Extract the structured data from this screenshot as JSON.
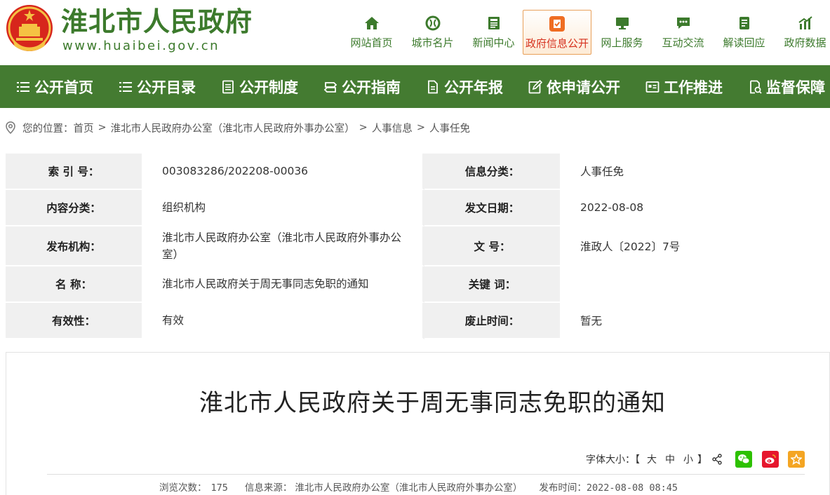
{
  "header": {
    "title": "淮北市人民政府",
    "url": "www.huaibei.gov.cn"
  },
  "topnav": [
    {
      "label": "网站首页",
      "icon": "home-icon"
    },
    {
      "label": "城市名片",
      "icon": "city-icon"
    },
    {
      "label": "新闻中心",
      "icon": "news-icon"
    },
    {
      "label": "政府信息公开",
      "icon": "info-open-icon",
      "active": true
    },
    {
      "label": "网上服务",
      "icon": "monitor-icon"
    },
    {
      "label": "互动交流",
      "icon": "chat-icon"
    },
    {
      "label": "解读回应",
      "icon": "document-icon"
    },
    {
      "label": "政府数据",
      "icon": "data-icon"
    }
  ],
  "greennav": [
    {
      "label": "公开首页",
      "icon": "list-icon"
    },
    {
      "label": "公开目录",
      "icon": "list-icon"
    },
    {
      "label": "公开制度",
      "icon": "doc-list-icon"
    },
    {
      "label": "公开指南",
      "icon": "guide-icon"
    },
    {
      "label": "公开年报",
      "icon": "report-icon"
    },
    {
      "label": "依申请公开",
      "icon": "edit-icon"
    },
    {
      "label": "工作推进",
      "icon": "card-icon"
    },
    {
      "label": "监督保障",
      "icon": "shield-icon"
    }
  ],
  "breadcrumb": {
    "prefix": "您的位置：",
    "items": [
      "首页",
      "淮北市人民政府办公室（淮北市人民政府外事办公室）",
      "人事信息",
      "人事任免"
    ],
    "sep": ">"
  },
  "info": {
    "index_label": "索 引 号：",
    "index_value": "003083286/202208-00036",
    "category_label": "信息分类：",
    "category_value": "人事任免",
    "content_label": "内容分类：",
    "content_value": "组织机构",
    "date_label": "发文日期：",
    "date_value": "2022-08-08",
    "publisher_label": "发布机构：",
    "publisher_value": "淮北市人民政府办公室（淮北市人民政府外事办公室）",
    "docno_label": "文 号：",
    "docno_value": "淮政人〔2022〕7号",
    "name_label": "名 称：",
    "name_value": "淮北市人民政府关于周无事同志免职的通知",
    "keyword_label": "关键 词：",
    "keyword_value": "",
    "validity_label": "有效性：",
    "validity_value": "有效",
    "abolish_label": "废止时间：",
    "abolish_value": "暂无"
  },
  "article": {
    "title": "淮北市人民政府关于周无事同志免职的通知",
    "font_size_label": "字体大小：【",
    "font_large": "大",
    "font_medium": "中",
    "font_small": "小",
    "font_close": "】",
    "views_label": "浏览次数：",
    "views_value": "175",
    "source_label": "信息来源：",
    "source_value": "淮北市人民政府办公室（淮北市人民政府外事办公室）",
    "published_label": "发布时间：",
    "published_value": "2022-08-08 08:45"
  },
  "colors": {
    "brand_green": "#447b31",
    "title_green": "#3c7a2c",
    "active_red": "#d6321e",
    "active_orange": "#ef6d22",
    "wechat": "#2dc100",
    "weibo": "#e6162d",
    "star": "#f4a523"
  }
}
